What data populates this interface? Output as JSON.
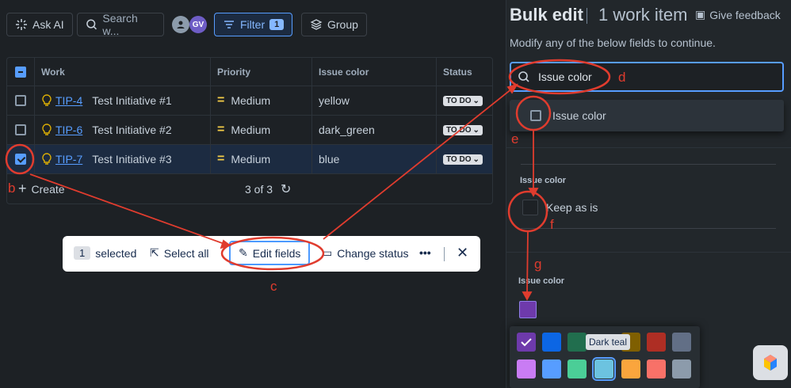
{
  "toolbar": {
    "ask_ai": "Ask AI",
    "search_placeholder": "Search w...",
    "avatar_initials": "GV",
    "filter_label": "Filter",
    "filter_count": "1",
    "group_label": "Group"
  },
  "table": {
    "headers": [
      "Work",
      "Priority",
      "Issue color",
      "Status"
    ],
    "rows": [
      {
        "key": "TIP-4",
        "summary": "Test Initiative #1",
        "priority": "Medium",
        "color": "yellow",
        "status": "TO DO",
        "checked": false
      },
      {
        "key": "TIP-6",
        "summary": "Test Initiative #2",
        "priority": "Medium",
        "color": "dark_green",
        "status": "TO DO",
        "checked": false
      },
      {
        "key": "TIP-7",
        "summary": "Test Initiative #3",
        "priority": "Medium",
        "color": "blue",
        "status": "TO DO",
        "checked": true
      }
    ],
    "create_label": "Create",
    "pagination": "3 of 3"
  },
  "bulkbar": {
    "count": "1",
    "selected_label": "selected",
    "select_all": "Select all",
    "edit_fields": "Edit fields",
    "change_status": "Change status"
  },
  "panel": {
    "title": "Bulk edit",
    "subtitle": "1 work item",
    "feedback": "Give feedback",
    "instruction": "Modify any of the below fields to continue.",
    "search_value": "Issue color",
    "dropdown_option": "Issue color",
    "section1_label": "Issue color",
    "keep_label": "Keep as is",
    "section2_label": "Issue color",
    "tooltip": "Dark teal"
  },
  "palette": {
    "row1": [
      "#6e3aab",
      "#0c66e4",
      "#216e4e",
      "#7f5f01",
      "#ae2e24",
      "#626f86"
    ],
    "row2": [
      "#c97cf4",
      "#579dff",
      "#4bce97",
      "#6cc3e0",
      "#faa53d",
      "#f87168",
      "#8c9bab"
    ]
  },
  "annotations": [
    "b",
    "c",
    "d",
    "e",
    "f",
    "g"
  ],
  "colors": {
    "accent": "#579dff",
    "annotation": "#e03c2e"
  }
}
